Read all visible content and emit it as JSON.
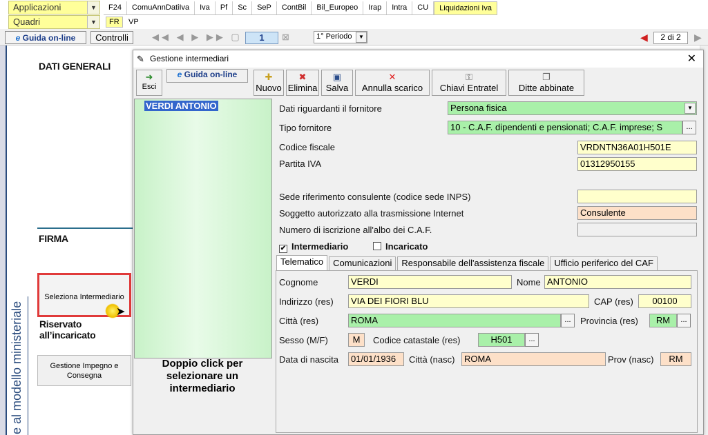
{
  "topbar": {
    "applicazioni": "Applicazioni",
    "quadri": "Quadri",
    "tabs": [
      "F24",
      "ComuAnnDatiIva",
      "Iva",
      "Pf",
      "Sc",
      "SeP",
      "ContBil",
      "Bil_Europeo",
      "Irap",
      "Intra",
      "CU",
      "Liquidazioni Iva"
    ],
    "subtabs": [
      "FR",
      "VP"
    ]
  },
  "toolbar": {
    "guida": "Guida on-line",
    "controlli": "Controlli",
    "page_num": "1",
    "periodo": "1° Periodo",
    "page_of": "2 di 2"
  },
  "leftpage": {
    "dati_generali": "DATI GENERALI",
    "firma": "FIRMA",
    "seleziona": "Seleziona Intermediario",
    "riservato": "Riservato all’incaricato",
    "gestione": "Gestione Impegno e Consegna",
    "vertical_text": "e al modello ministeriale"
  },
  "dialog": {
    "title": "Gestione intermediari",
    "buttons": {
      "esci": "Esci",
      "guida": "Guida on-line",
      "nuovo": "Nuovo",
      "elimina": "Elimina",
      "salva": "Salva",
      "annulla": "Annulla scarico",
      "chiavi": "Chiavi Entratel",
      "ditte": "Ditte abbinate"
    },
    "list": {
      "selected": "VERDI ANTONIO",
      "hint": "Doppio click per selezionare un intermediario"
    },
    "form": {
      "dati_fornitore_label": "Dati riguardanti il fornitore",
      "dati_fornitore_value": "Persona fisica",
      "tipo_fornitore_label": "Tipo fornitore",
      "tipo_fornitore_value": "10 - C.A.F. dipendenti e pensionati; C.A.F. imprese; S",
      "cf_label": "Codice fiscale",
      "cf_value": "VRDNTN36A01H501E",
      "piva_label": "Partita IVA",
      "piva_value": "01312950155",
      "sede_label": "Sede riferimento consulente (codice sede INPS)",
      "sede_value": "",
      "soggetto_label": "Soggetto autorizzato alla trasmissione Internet",
      "soggetto_value": "Consulente",
      "numero_label": "Numero di iscrizione all'albo dei C.A.F.",
      "numero_value": "",
      "intermediario": "Intermediario",
      "incaricato": "Incaricato"
    },
    "tabs": [
      "Telematico",
      "Comunicazioni",
      "Responsabile dell'assistenza fiscale",
      "Ufficio periferico del CAF"
    ],
    "telematico": {
      "cognome_label": "Cognome",
      "cognome": "VERDI",
      "nome_label": "Nome",
      "nome": "ANTONIO",
      "indirizzo_label": "Indirizzo (res)",
      "indirizzo": "VIA DEI FIORI BLU",
      "cap_label": "CAP (res)",
      "cap": "00100",
      "citta_label": "Città (res)",
      "citta": "ROMA",
      "provincia_label": "Provincia (res)",
      "provincia": "RM",
      "sesso_label": "Sesso (M/F)",
      "sesso": "M",
      "catastale_label": "Codice catastale (res)",
      "catastale": "H501",
      "nascita_label": "Data di nascita",
      "nascita": "01/01/1936",
      "citta_nasc_label": "Città (nasc)",
      "citta_nasc": "ROMA",
      "prov_nasc_label": "Prov (nasc)",
      "prov_nasc": "RM"
    }
  }
}
